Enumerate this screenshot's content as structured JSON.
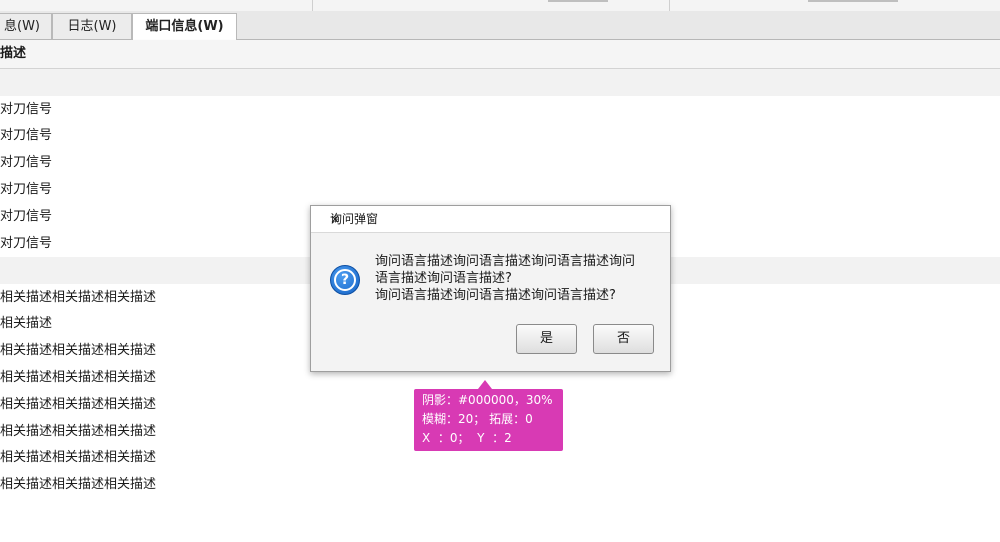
{
  "tabs": [
    {
      "label": "息(W)"
    },
    {
      "label": "日志(W)"
    },
    {
      "label": "端口信息(W)",
      "active": true
    }
  ],
  "table": {
    "header": "描述",
    "group1_rows": [
      "对刀信号",
      "对刀信号",
      "对刀信号",
      "对刀信号",
      "对刀信号",
      "对刀信号"
    ],
    "group2_rows": [
      "相关描述相关描述相关描述",
      "相关描述",
      "相关描述相关描述相关描述",
      "相关描述相关描述相关描述",
      "相关描述相关描述相关描述",
      "相关描述相关描述相关描述",
      "相关描述相关描述相关描述",
      "相关描述相关描述相关描述"
    ]
  },
  "dialog": {
    "title": "询问弹窗",
    "close": "×",
    "message_line1": "询问语言描述询问语言描述询问语言描述询问",
    "message_line2": "语言描述询问语言描述?",
    "message_line3": "询问语言描述询问语言描述询问语言描述?",
    "yes_label": "是",
    "no_label": "否",
    "icon": "question-icon"
  },
  "annotation": {
    "line1": "阴影：#000000，30%",
    "line2": "模糊：20； 拓展：0",
    "line3": "X  ：0；  Y  ：2",
    "color": "#d83ab4"
  }
}
